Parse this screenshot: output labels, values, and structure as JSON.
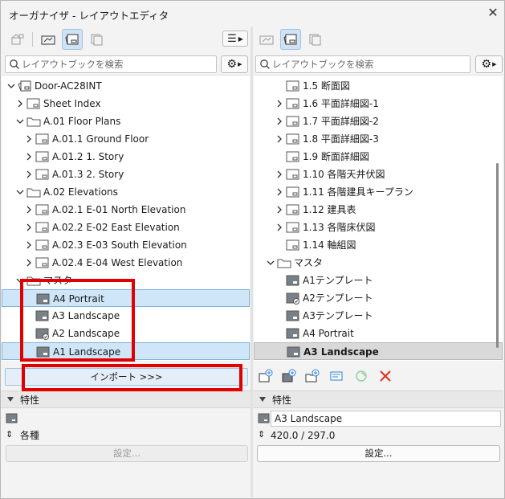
{
  "window": {
    "title": "オーガナイザ - レイアウトエディタ"
  },
  "left": {
    "search_placeholder": "レイアウトブックを検索",
    "tree": [
      {
        "label": "Door-AC28INT",
        "icon": "project-icon",
        "chevron": "down",
        "indent": 0
      },
      {
        "label": "Sheet Index",
        "icon": "layout-icon",
        "chevron": "right",
        "indent": 1
      },
      {
        "label": "A.01 Floor Plans",
        "icon": "folder-icon",
        "chevron": "down",
        "indent": 1
      },
      {
        "label": "A.01.1 Ground Floor",
        "icon": "layout-icon",
        "chevron": "right",
        "indent": 2
      },
      {
        "label": "A.01.2 1. Story",
        "icon": "layout-icon",
        "chevron": "right",
        "indent": 2
      },
      {
        "label": "A.01.3 2. Story",
        "icon": "layout-icon",
        "chevron": "right",
        "indent": 2
      },
      {
        "label": "A.02 Elevations",
        "icon": "folder-icon",
        "chevron": "down",
        "indent": 1
      },
      {
        "label": "A.02.1 E-01 North Elevation",
        "icon": "layout-icon",
        "chevron": "right",
        "indent": 2
      },
      {
        "label": "A.02.2 E-02 East Elevation",
        "icon": "layout-icon",
        "chevron": "right",
        "indent": 2
      },
      {
        "label": "A.02.3 E-03 South Elevation",
        "icon": "layout-icon",
        "chevron": "right",
        "indent": 2
      },
      {
        "label": "A.02.4 E-04 West Elevation",
        "icon": "layout-icon",
        "chevron": "right",
        "indent": 2
      },
      {
        "label": "マスタ",
        "icon": "folder-icon",
        "chevron": "down",
        "indent": 1
      },
      {
        "label": "A4 Portrait",
        "icon": "master-icon",
        "chevron": "none",
        "indent": 2,
        "state": "selected"
      },
      {
        "label": "A3 Landscape",
        "icon": "master-icon",
        "chevron": "none",
        "indent": 2
      },
      {
        "label": "A2 Landscape",
        "icon": "master-check-icon",
        "chevron": "none",
        "indent": 2
      },
      {
        "label": "A1 Landscape",
        "icon": "master-icon",
        "chevron": "none",
        "indent": 2,
        "state": "selected"
      }
    ],
    "import_label": "インポート >>>",
    "properties_label": "特性",
    "prop_value": "各種",
    "settings_label": "設定..."
  },
  "right": {
    "search_placeholder": "レイアウトブックを検索",
    "tree": [
      {
        "label": "1.5 断面図",
        "icon": "layout-icon",
        "chevron": "none",
        "indent": 2
      },
      {
        "label": "1.6 平面詳細図-1",
        "icon": "layout-icon",
        "chevron": "right",
        "indent": 2
      },
      {
        "label": "1.7 平面詳細図-2",
        "icon": "layout-icon",
        "chevron": "right",
        "indent": 2
      },
      {
        "label": "1.8 平面詳細図-3",
        "icon": "layout-icon",
        "chevron": "right",
        "indent": 2
      },
      {
        "label": "1.9 断面詳細図",
        "icon": "layout-icon",
        "chevron": "none",
        "indent": 2
      },
      {
        "label": "1.10 各階天井伏図",
        "icon": "layout-icon",
        "chevron": "right",
        "indent": 2
      },
      {
        "label": "1.11 各階建具キープラン",
        "icon": "layout-icon",
        "chevron": "right",
        "indent": 2
      },
      {
        "label": "1.12 建具表",
        "icon": "layout-icon",
        "chevron": "right",
        "indent": 2
      },
      {
        "label": "1.13 各階床伏図",
        "icon": "layout-icon",
        "chevron": "right",
        "indent": 2
      },
      {
        "label": "1.14 軸組図",
        "icon": "layout-icon",
        "chevron": "none",
        "indent": 2
      },
      {
        "label": "マスタ",
        "icon": "folder-icon",
        "chevron": "down",
        "indent": 1
      },
      {
        "label": "A1テンプレート",
        "icon": "master-icon",
        "chevron": "none",
        "indent": 2
      },
      {
        "label": "A2テンプレート",
        "icon": "master-check-icon",
        "chevron": "none",
        "indent": 2
      },
      {
        "label": "A3テンプレート",
        "icon": "master-icon",
        "chevron": "none",
        "indent": 2
      },
      {
        "label": "A4 Portrait",
        "icon": "master-icon",
        "chevron": "none",
        "indent": 2
      },
      {
        "label": "A3 Landscape",
        "icon": "master-icon",
        "chevron": "none",
        "indent": 2,
        "state": "current"
      }
    ],
    "properties_label": "特性",
    "name_value": "A3 Landscape",
    "size_value": "420.0 / 297.0",
    "settings_label": "設定..."
  },
  "colors": {
    "highlight": "#e00000",
    "selection": "#cfe6f8",
    "delete": "#e0301e"
  }
}
